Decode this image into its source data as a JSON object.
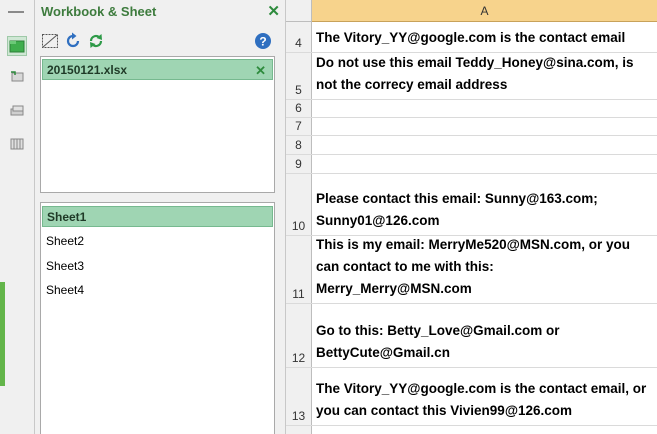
{
  "pane": {
    "title": "Workbook & Sheet",
    "close_symbol": "✕",
    "toolbar": {
      "buttons": [
        "filter-icon",
        "refresh-icon",
        "sync-icon",
        "help-icon"
      ]
    },
    "workbooks": [
      {
        "name": "20150121.xlsx",
        "close_symbol": "✕"
      }
    ],
    "sheets": [
      "Sheet1",
      "Sheet2",
      "Sheet3",
      "Sheet4"
    ],
    "selected_sheet": "Sheet1"
  },
  "side_strip": {
    "icons": [
      "workbook-sheet-icon",
      "autotext-icon",
      "layers-icon",
      "columns-icon"
    ]
  },
  "sheet": {
    "column": "A",
    "rows": [
      {
        "num": "4",
        "text": "The Vitory_YY@google.com is the contact email"
      },
      {
        "num": "5",
        "text": "Do not use this email Teddy_Honey@sina.com, is not the correcy email address"
      },
      {
        "num": "6",
        "text": ""
      },
      {
        "num": "7",
        "text": ""
      },
      {
        "num": "8",
        "text": ""
      },
      {
        "num": "9",
        "text": ""
      },
      {
        "num": "10",
        "text": "Please contact this email: Sunny@163.com; Sunny01@126.com"
      },
      {
        "num": "11",
        "text": "This is my email: MerryMe520@MSN.com, or you can contact to me with this: Merry_Merry@MSN.com"
      },
      {
        "num": "12",
        "text": "Go to this: Betty_Love@Gmail.com or BettyCute@Gmail.cn"
      },
      {
        "num": "13",
        "text": "The Vitory_YY@google.com is the contact email, or you can contact this Vivien99@126.com"
      }
    ]
  },
  "colors": {
    "accent_green": "#2e8b3d",
    "selection_green": "#9fd5b3",
    "column_header_orange": "#f7d38c"
  }
}
